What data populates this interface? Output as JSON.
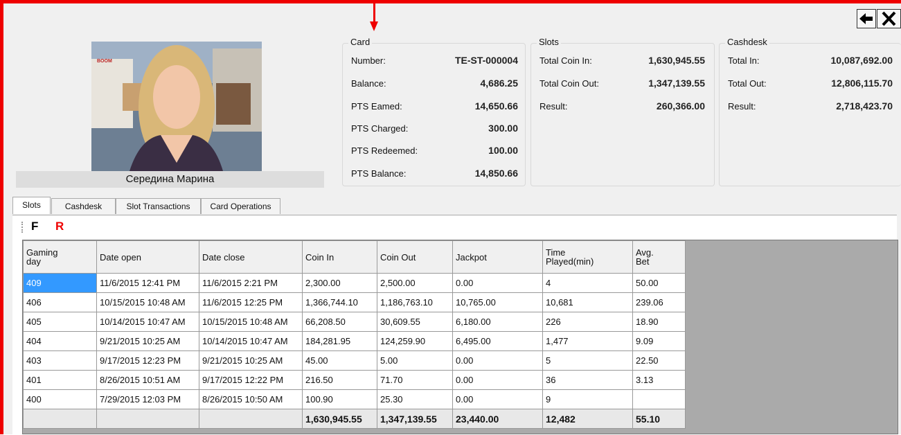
{
  "person": {
    "name": "Середина Марина",
    "photo_sign_text": "BOOM"
  },
  "card": {
    "title": "Card",
    "rows": [
      {
        "label": "Number:",
        "value": "TE-ST-000004"
      },
      {
        "label": "Balance:",
        "value": "4,686.25"
      },
      {
        "label": "PTS Eamed:",
        "value": "14,650.66"
      },
      {
        "label": "PTS Charged:",
        "value": "300.00"
      },
      {
        "label": "PTS Redeemed:",
        "value": "100.00"
      },
      {
        "label": "PTS Balance:",
        "value": "14,850.66"
      }
    ]
  },
  "slots": {
    "title": "Slots",
    "rows": [
      {
        "label": "Total Coin In:",
        "value": "1,630,945.55"
      },
      {
        "label": "Total Coin Out:",
        "value": "1,347,139.55"
      },
      {
        "label": "Result:",
        "value": "260,366.00"
      }
    ]
  },
  "cashdesk": {
    "title": "Cashdesk",
    "rows": [
      {
        "label": "Total In:",
        "value": "10,087,692.00"
      },
      {
        "label": "Total Out:",
        "value": "12,806,115.70"
      },
      {
        "label": "Result:",
        "value": "2,718,423.70"
      }
    ]
  },
  "tabs": [
    "Slots",
    "Cashdesk",
    "Slot Transactions",
    "Card Operations"
  ],
  "toolbar": {
    "f_label": "F",
    "r_label": "R"
  },
  "table": {
    "headers": [
      "Gaming\nday",
      "Date open",
      "Date close",
      "Coin In",
      "Coin Out",
      "Jackpot",
      "Time\nPlayed(min)",
      "Avg.\nBet"
    ],
    "rows": [
      [
        "409",
        "11/6/2015 12:41 PM",
        "11/6/2015 2:21 PM",
        "2,300.00",
        "2,500.00",
        "0.00",
        "4",
        "50.00"
      ],
      [
        "406",
        "10/15/2015 10:48 AM",
        "11/6/2015 12:25 PM",
        "1,366,744.10",
        "1,186,763.10",
        "10,765.00",
        "10,681",
        "239.06"
      ],
      [
        "405",
        "10/14/2015 10:47 AM",
        "10/15/2015 10:48 AM",
        "66,208.50",
        "30,609.55",
        "6,180.00",
        "226",
        "18.90"
      ],
      [
        "404",
        "9/21/2015 10:25 AM",
        "10/14/2015 10:47 AM",
        "184,281.95",
        "124,259.90",
        "6,495.00",
        "1,477",
        "9.09"
      ],
      [
        "403",
        "9/17/2015 12:23 PM",
        "9/21/2015 10:25 AM",
        "45.00",
        "5.00",
        "0.00",
        "5",
        "22.50"
      ],
      [
        "401",
        "8/26/2015 10:51 AM",
        "9/17/2015 12:22 PM",
        "216.50",
        "71.70",
        "0.00",
        "36",
        "3.13"
      ],
      [
        "400",
        "7/29/2015 12:03 PM",
        "8/26/2015 10:50 AM",
        "100.90",
        "25.30",
        "0.00",
        "9",
        ""
      ]
    ],
    "totals": [
      "",
      "",
      "",
      "1,630,945.55",
      "1,347,139.55",
      "23,440.00",
      "12,482",
      "55.10"
    ]
  },
  "colors": {
    "frame": "#e00000",
    "selection": "#3399ff",
    "r_accent": "#e00000"
  },
  "icons": {
    "back": "arrow-left-icon",
    "close": "close-icon",
    "marker": "arrow-down-icon"
  }
}
